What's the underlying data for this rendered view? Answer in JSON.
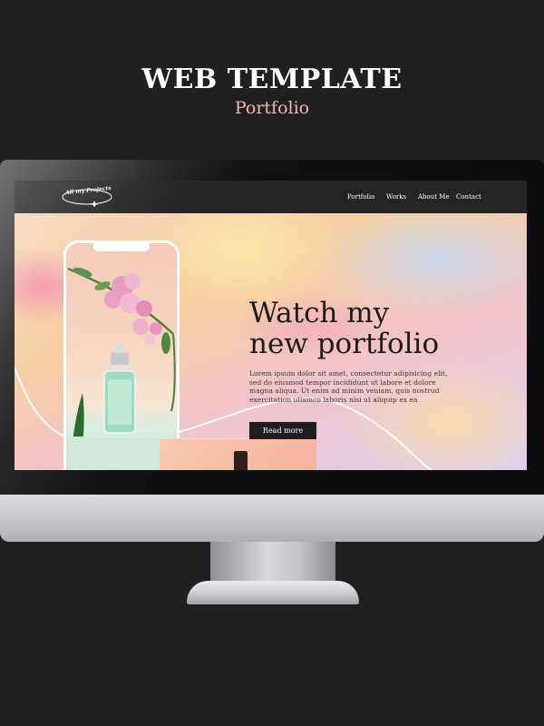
{
  "poster": {
    "title": "WEB TEMPLATE",
    "subtitle": "Portfolio"
  },
  "site": {
    "logo_text": "All my Projects",
    "nav": [
      {
        "label": "Portfolio"
      },
      {
        "label": "Works"
      },
      {
        "label": "About Me"
      },
      {
        "label": "Contact"
      }
    ],
    "hero": {
      "headline_line1": "Watch my",
      "headline_line2": "new portfolio",
      "body": "Lorem ipsum dolor sit amet, consectetur adipisicing elit, sed do eiusmod tempor incididunt ut labore et dolore magna aliqua. Ut enim ad minim veniam, quis nostrud exercitation ullamco laboris nisi ut aliquip ex ea",
      "cta_label": "Read more"
    }
  },
  "colors": {
    "page_background": "#202020",
    "subtitle_accent": "#f2b8b4",
    "nav_background": "#242424",
    "button_background": "#1e1e1e"
  },
  "icons": {
    "logo": "orbit-star-logo-icon"
  }
}
